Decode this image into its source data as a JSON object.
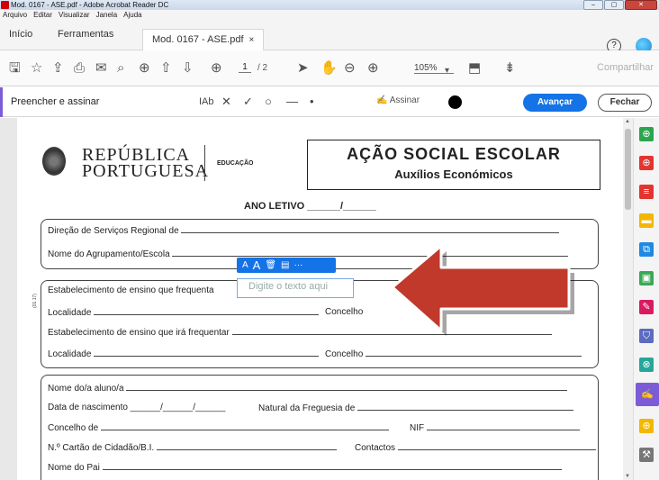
{
  "window": {
    "title": "Mod. 0167 - ASE.pdf - Adobe Acrobat Reader DC",
    "controls": [
      "–",
      "▢",
      "✕"
    ]
  },
  "menu": [
    "Arquivo",
    "Editar",
    "Visualizar",
    "Janela",
    "Ajuda"
  ],
  "tabs": {
    "home": "Início",
    "tools": "Ferramentas",
    "document": "Mod. 0167 - ASE.pdf",
    "document_close": "×"
  },
  "toolbar": {
    "page_current": "1",
    "page_total": "/ 2",
    "zoom": "105%",
    "share": "Compartilhar"
  },
  "fillsign": {
    "title": "Preencher e assinar",
    "text_tool": "IAb",
    "sign": "Assinar",
    "next": "Avançar",
    "close": "Fechar"
  },
  "document": {
    "rep_line1": "REPÚBLICA",
    "rep_line2": "PORTUGUESA",
    "education": "EDUCAÇÃO",
    "title": "AÇÃO SOCIAL ESCOLAR",
    "subtitle": "Auxílios Económicos",
    "school_year": "ANO LETIVO ______/______",
    "margin_code": "(01.17)",
    "section1": {
      "dir_servicos": "Direção de Serviços Regional de",
      "agrupamento": "Nome do Agrupamento/Escola"
    },
    "section2": {
      "estab_atual": "Estabelecimento de ensino que frequenta",
      "localidade": "Localidade",
      "concelho": "Concelho",
      "estab_futuro": "Estabelecimento de ensino que irá frequentar",
      "localidade2": "Localidade",
      "concelho2": "Concelho"
    },
    "section3": {
      "nome_aluno": "Nome do/a aluno/a",
      "nascimento": "Data de nascimento",
      "freguesia": "Natural da Freguesia de",
      "concelho": "Concelho de",
      "nif": "NIF",
      "cartao": "N.º Cartão de Cidadão/B.I.",
      "contactos": "Contactos",
      "nome_pai": "Nome do Pai"
    }
  },
  "overlay": {
    "tool_small_a": "A",
    "tool_big_a": "A",
    "tool_more": "···",
    "placeholder": "Digite o texto aqui",
    "arrow_color": "#c0392b"
  },
  "colors": {
    "accent": "#1473e6",
    "fillsign": "#7c5cd6"
  }
}
